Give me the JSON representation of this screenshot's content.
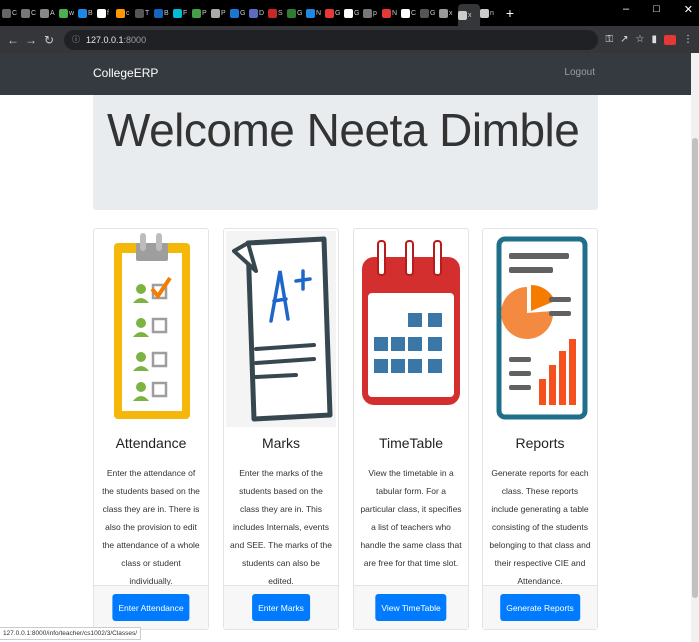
{
  "browser": {
    "tabs": [
      {
        "label": "C",
        "color": "#666"
      },
      {
        "label": "C",
        "color": "#777"
      },
      {
        "label": "A",
        "color": "#888"
      },
      {
        "label": "w",
        "color": "#4caf50"
      },
      {
        "label": "B",
        "color": "#1e88e5"
      },
      {
        "label": "f",
        "color": "#fff"
      },
      {
        "label": "c",
        "color": "#ff9800"
      },
      {
        "label": "T",
        "color": "#555"
      },
      {
        "label": "B",
        "color": "#1565c0"
      },
      {
        "label": "F",
        "color": "#00bcd4"
      },
      {
        "label": "P",
        "color": "#43a047"
      },
      {
        "label": "P",
        "color": "#aaa"
      },
      {
        "label": "G",
        "color": "#1976d2"
      },
      {
        "label": "D",
        "color": "#5c6bc0"
      },
      {
        "label": "S",
        "color": "#c62828"
      },
      {
        "label": "G",
        "color": "#2e7d32"
      },
      {
        "label": "N",
        "color": "#1e88e5"
      },
      {
        "label": "G",
        "color": "#e53935"
      },
      {
        "label": "G",
        "color": "#fff"
      },
      {
        "label": "p",
        "color": "#777"
      },
      {
        "label": "N",
        "color": "#e53935"
      },
      {
        "label": "C",
        "color": "#fff"
      },
      {
        "label": "G",
        "color": "#555"
      },
      {
        "label": "x",
        "color": "#999"
      },
      {
        "label": "x",
        "color": "#ccc"
      },
      {
        "label": "n",
        "color": "#ccc"
      }
    ],
    "new_tab": "+",
    "url_host": "127.0.0.1",
    "url_port": ":8000",
    "status_url": "127.0.0.1:8000/info/teacher/cs1002/3/Classes/"
  },
  "navbar": {
    "brand": "CollegeERP",
    "logout": "Logout"
  },
  "jumbotron": {
    "welcome": "Welcome Neeta Dimble"
  },
  "cards": [
    {
      "title": "Attendance",
      "description": "Enter the attendance of the students based on the class they are in. There is also the provision to edit the attendance of a whole class or student individually.",
      "button": "Enter Attendance"
    },
    {
      "title": "Marks",
      "description": "Enter the marks of the students based on the class they are in. This includes Internals, events and SEE. The marks of the students can also be edited.",
      "button": "Enter Marks"
    },
    {
      "title": "TimeTable",
      "description": "View the timetable in a tabular form. For a particular class, it specifies a list of teachers who handle the same class that are free for that time slot.",
      "button": "View TimeTable"
    },
    {
      "title": "Reports",
      "description": "Generate reports for each class. These reports include generating a table consisting of the students belonging to that class and their respective CIE and Attendance.",
      "button": "Generate Reports"
    }
  ],
  "colors": {
    "navbar": "#343a40",
    "jumbotron": "#e9ecef",
    "primary_button": "#007bff"
  }
}
